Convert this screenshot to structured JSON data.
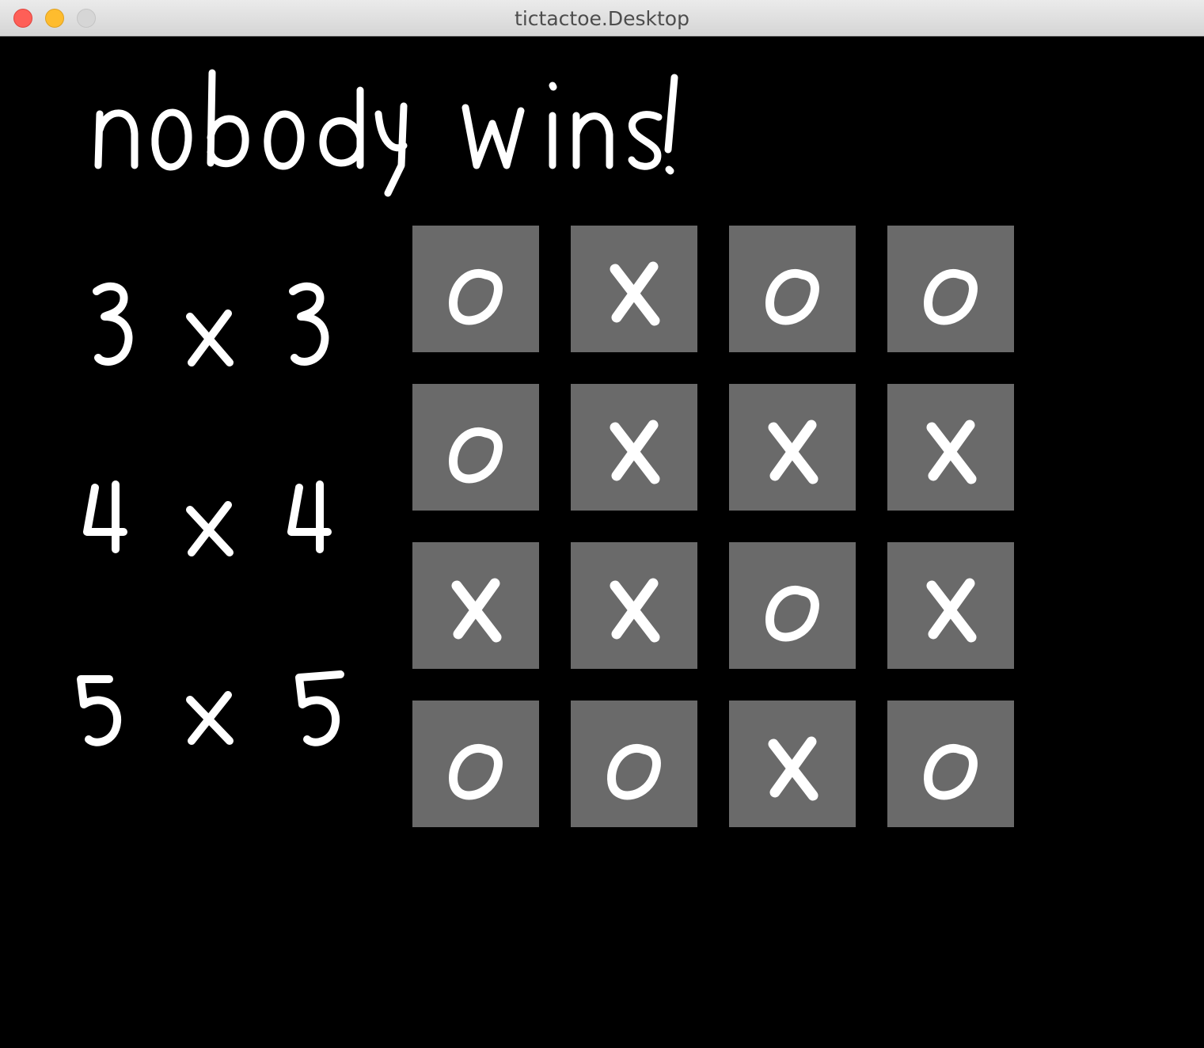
{
  "window": {
    "title": "tictactoe.Desktop"
  },
  "status": {
    "text": "nobody wins!"
  },
  "size_options": [
    {
      "label": "3 x 3"
    },
    {
      "label": "4 x 4"
    },
    {
      "label": "5 x 5"
    }
  ],
  "board": {
    "size": 4,
    "cells": [
      [
        "O",
        "X",
        "O",
        "O"
      ],
      [
        "O",
        "X",
        "X",
        "X"
      ],
      [
        "X",
        "X",
        "O",
        "X"
      ],
      [
        "O",
        "O",
        "X",
        "O"
      ]
    ]
  },
  "colors": {
    "background": "#000000",
    "cell": "#6a6a6a",
    "mark": "#ffffff"
  }
}
